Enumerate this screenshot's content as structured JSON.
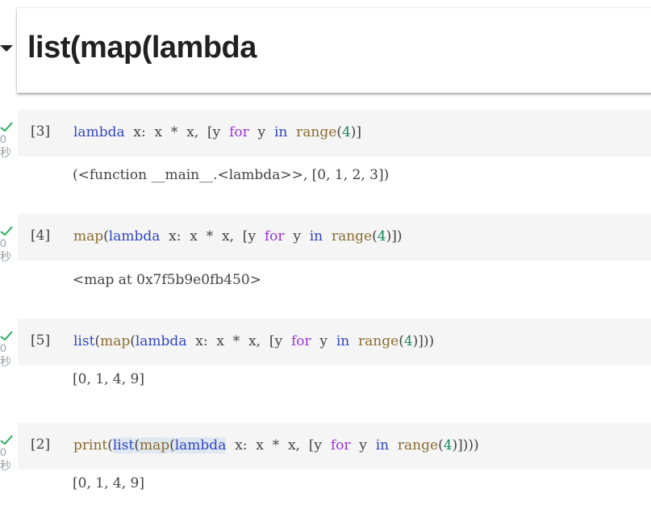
{
  "heading": {
    "text": "list(map(lambda"
  },
  "cells": [
    {
      "exec_count": "[3]",
      "exec_time": "0",
      "exec_unit": "秒",
      "code": [
        {
          "t": "lambda",
          "c": "kwblue"
        },
        {
          "t": "  x:  x  *  x,  [y  "
        },
        {
          "t": "for",
          "c": "kw"
        },
        {
          "t": "  y  "
        },
        {
          "t": "in",
          "c": "kwblue"
        },
        {
          "t": "  "
        },
        {
          "t": "range",
          "c": "builtin"
        },
        {
          "t": "("
        },
        {
          "t": "4",
          "c": "num"
        },
        {
          "t": ")]"
        }
      ],
      "output": "(<function __main__.<lambda>>, [0, 1, 2, 3])"
    },
    {
      "exec_count": "[4]",
      "exec_time": "0",
      "exec_unit": "秒",
      "code": [
        {
          "t": "map",
          "c": "builtin"
        },
        {
          "t": "("
        },
        {
          "t": "lambda",
          "c": "kwblue"
        },
        {
          "t": "  x:  x  *  x,  [y  "
        },
        {
          "t": "for",
          "c": "kw"
        },
        {
          "t": "  y  "
        },
        {
          "t": "in",
          "c": "kwblue"
        },
        {
          "t": "  "
        },
        {
          "t": "range",
          "c": "builtin"
        },
        {
          "t": "("
        },
        {
          "t": "4",
          "c": "num"
        },
        {
          "t": ")])"
        }
      ],
      "output": "<map at 0x7f5b9e0fb450>"
    },
    {
      "exec_count": "[5]",
      "exec_time": "0",
      "exec_unit": "秒",
      "code": [
        {
          "t": "list",
          "c": "kwblue"
        },
        {
          "t": "("
        },
        {
          "t": "map",
          "c": "builtin"
        },
        {
          "t": "("
        },
        {
          "t": "lambda",
          "c": "kwblue"
        },
        {
          "t": "  x:  x  *  x,  [y  "
        },
        {
          "t": "for",
          "c": "kw"
        },
        {
          "t": "  y  "
        },
        {
          "t": "in",
          "c": "kwblue"
        },
        {
          "t": "  "
        },
        {
          "t": "range",
          "c": "builtin"
        },
        {
          "t": "("
        },
        {
          "t": "4",
          "c": "num"
        },
        {
          "t": ")]))"
        }
      ],
      "output": "[0, 1, 4, 9]"
    },
    {
      "exec_count": "[2]",
      "exec_time": "0",
      "exec_unit": "秒",
      "code": [
        {
          "t": "print",
          "c": "builtin"
        },
        {
          "t": "("
        },
        {
          "t": "list",
          "c": "kwblue",
          "hl": true
        },
        {
          "t": "(",
          "hl": true
        },
        {
          "t": "map",
          "c": "builtin",
          "hl": true
        },
        {
          "t": "(",
          "hl": true
        },
        {
          "t": "lambda",
          "c": "kwblue",
          "hl": true
        },
        {
          "t": "  x:  x  *  x,  [y  "
        },
        {
          "t": "for",
          "c": "kw"
        },
        {
          "t": "  y  "
        },
        {
          "t": "in",
          "c": "kwblue"
        },
        {
          "t": "  "
        },
        {
          "t": "range",
          "c": "builtin"
        },
        {
          "t": "("
        },
        {
          "t": "4",
          "c": "num"
        },
        {
          "t": ")])))"
        }
      ],
      "output": "[0, 1, 4, 9]"
    }
  ],
  "colors": {
    "check": "#27ae60",
    "code_bg": "#f5f5f5",
    "keyword_purple": "#9b33d8",
    "keyword_blue": "#2f45c4",
    "builtin": "#8b6b2e",
    "number": "#14865c"
  },
  "icons": {
    "status": "check-icon",
    "collapse": "caret-down-icon"
  }
}
